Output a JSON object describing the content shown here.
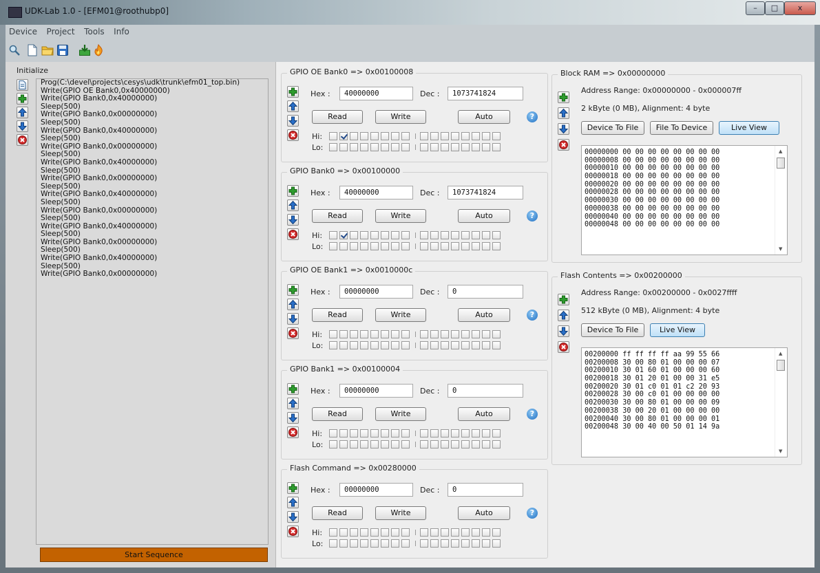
{
  "window": {
    "title": "UDK-Lab 1.0 - [EFM01@roothubp0]",
    "controls": [
      "–",
      "□",
      "x"
    ]
  },
  "menu": [
    "Device",
    "Project",
    "Tools",
    "Info"
  ],
  "toolbar_icons": [
    "search-icon",
    "new-file-icon",
    "open-folder-icon",
    "save-icon",
    "download-icon",
    "flame-icon"
  ],
  "initialize": {
    "label": "Initialize",
    "items": [
      "Prog(C:\\devel\\projects\\cesys\\udk\\trunk\\efm01_top.bin)",
      "Write(GPIO OE Bank0,0x40000000)",
      "Write(GPIO Bank0,0x40000000)",
      "Sleep(500)",
      "Write(GPIO Bank0,0x00000000)",
      "Sleep(500)",
      "Write(GPIO Bank0,0x40000000)",
      "Sleep(500)",
      "Write(GPIO Bank0,0x00000000)",
      "Sleep(500)",
      "Write(GPIO Bank0,0x40000000)",
      "Sleep(500)",
      "Write(GPIO Bank0,0x00000000)",
      "Sleep(500)",
      "Write(GPIO Bank0,0x40000000)",
      "Sleep(500)",
      "Write(GPIO Bank0,0x00000000)",
      "Sleep(500)",
      "Write(GPIO Bank0,0x40000000)",
      "Sleep(500)",
      "Write(GPIO Bank0,0x00000000)",
      "Sleep(500)",
      "Write(GPIO Bank0,0x40000000)",
      "Sleep(500)",
      "Write(GPIO Bank0,0x00000000)"
    ],
    "start_button": "Start Sequence"
  },
  "common": {
    "hex_label": "Hex :",
    "dec_label": "Dec :",
    "read": "Read",
    "write": "Write",
    "auto": "Auto",
    "hi": "Hi:",
    "lo": "Lo:",
    "help": "?"
  },
  "registers": [
    {
      "title": "GPIO OE Bank0 => 0x00100008",
      "hex": "40000000",
      "dec": "1073741824",
      "hi_bits": [
        0,
        1,
        0,
        0,
        0,
        0,
        0,
        0,
        0,
        0,
        0,
        0,
        0,
        0,
        0,
        0
      ],
      "lo_bits": [
        0,
        0,
        0,
        0,
        0,
        0,
        0,
        0,
        0,
        0,
        0,
        0,
        0,
        0,
        0,
        0
      ]
    },
    {
      "title": "GPIO Bank0 => 0x00100000",
      "hex": "40000000",
      "dec": "1073741824",
      "hi_bits": [
        0,
        1,
        0,
        0,
        0,
        0,
        0,
        0,
        0,
        0,
        0,
        0,
        0,
        0,
        0,
        0
      ],
      "lo_bits": [
        0,
        0,
        0,
        0,
        0,
        0,
        0,
        0,
        0,
        0,
        0,
        0,
        0,
        0,
        0,
        0
      ]
    },
    {
      "title": "GPIO OE Bank1 => 0x0010000c",
      "hex": "00000000",
      "dec": "0",
      "hi_bits": [
        0,
        0,
        0,
        0,
        0,
        0,
        0,
        0,
        0,
        0,
        0,
        0,
        0,
        0,
        0,
        0
      ],
      "lo_bits": [
        0,
        0,
        0,
        0,
        0,
        0,
        0,
        0,
        0,
        0,
        0,
        0,
        0,
        0,
        0,
        0
      ]
    },
    {
      "title": "GPIO Bank1 => 0x00100004",
      "hex": "00000000",
      "dec": "0",
      "hi_bits": [
        0,
        0,
        0,
        0,
        0,
        0,
        0,
        0,
        0,
        0,
        0,
        0,
        0,
        0,
        0,
        0
      ],
      "lo_bits": [
        0,
        0,
        0,
        0,
        0,
        0,
        0,
        0,
        0,
        0,
        0,
        0,
        0,
        0,
        0,
        0
      ]
    },
    {
      "title": "Flash Command => 0x00280000",
      "hex": "00000000",
      "dec": "0",
      "hi_bits": [
        0,
        0,
        0,
        0,
        0,
        0,
        0,
        0,
        0,
        0,
        0,
        0,
        0,
        0,
        0,
        0
      ],
      "lo_bits": [
        0,
        0,
        0,
        0,
        0,
        0,
        0,
        0,
        0,
        0,
        0,
        0,
        0,
        0,
        0,
        0
      ]
    }
  ],
  "block_ram": {
    "title": "Block RAM => 0x00000000",
    "range": "Address Range: 0x00000000 - 0x000007ff",
    "size": "2 kByte (0 MB), Alignment: 4 byte",
    "buttons": [
      "Device To File",
      "File To Device",
      "Live View"
    ],
    "rows": [
      "00000000 00 00 00 00 00 00 00 00",
      "00000008 00 00 00 00 00 00 00 00",
      "00000010 00 00 00 00 00 00 00 00",
      "00000018 00 00 00 00 00 00 00 00",
      "00000020 00 00 00 00 00 00 00 00",
      "00000028 00 00 00 00 00 00 00 00",
      "00000030 00 00 00 00 00 00 00 00",
      "00000038 00 00 00 00 00 00 00 00",
      "00000040 00 00 00 00 00 00 00 00",
      "00000048 00 00 00 00 00 00 00 00"
    ]
  },
  "flash": {
    "title": "Flash Contents => 0x00200000",
    "range": "Address Range: 0x00200000 - 0x0027ffff",
    "size": "512 kByte (0 MB), Alignment: 4 byte",
    "buttons": [
      "Device To File",
      "Live View"
    ],
    "rows": [
      "00200000 ff ff ff ff aa 99 55 66",
      "00200008 30 00 80 01 00 00 00 07",
      "00200010 30 01 60 01 00 00 00 60",
      "00200018 30 01 20 01 00 00 31 e5",
      "00200020 30 01 c0 01 01 c2 20 93",
      "00200028 30 00 c0 01 00 00 00 00",
      "00200030 30 00 80 01 00 00 00 09",
      "00200038 30 00 20 01 00 00 00 00",
      "00200040 30 00 80 01 00 00 00 01",
      "00200048 30 00 40 00 50 01 14 9a"
    ]
  },
  "colors": {
    "start_button": "#c36200",
    "live_view": "#bfe0f7",
    "help": "#1f6fc3",
    "add": "#2e9b2e",
    "move": "#2a6fc7",
    "remove": "#d22a2a"
  }
}
